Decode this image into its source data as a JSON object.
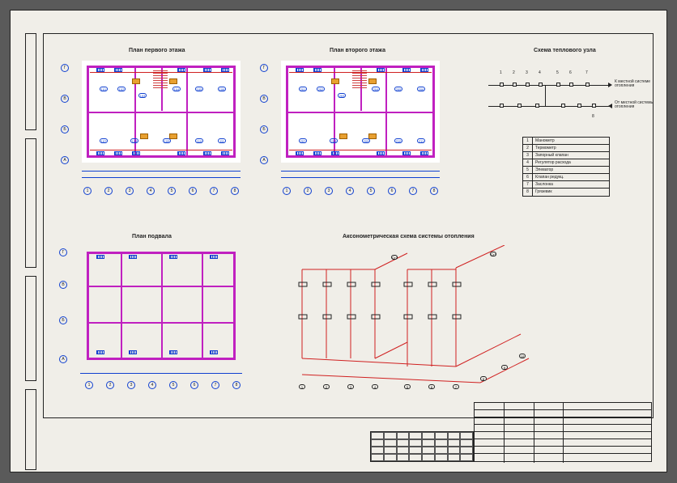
{
  "titles": {
    "plan1": "План первого этажа",
    "plan2": "План второго этажа",
    "thermal": "Схема теплового узла",
    "basement": "План подвала",
    "axo": "Аксонометрическая схема системы отопления"
  },
  "thermal_labels": {
    "to_local": "К местной системе отопления",
    "from_local": "От местной системы отопления"
  },
  "legend": [
    {
      "n": "1",
      "t": "Манометр"
    },
    {
      "n": "2",
      "t": "Термометр"
    },
    {
      "n": "3",
      "t": "Запорный клапан"
    },
    {
      "n": "4",
      "t": "Регулятор расхода"
    },
    {
      "n": "5",
      "t": "Элеватор"
    },
    {
      "n": "6",
      "t": "Клапан редукц."
    },
    {
      "n": "7",
      "t": "Заслонка"
    },
    {
      "n": "8",
      "t": "Грязевик"
    }
  ],
  "grid_axes_letters": [
    "А",
    "Б",
    "В",
    "Г"
  ],
  "grid_axes_numbers": [
    "1",
    "2",
    "3",
    "4",
    "5",
    "6",
    "7",
    "8"
  ],
  "room_tags": [
    "101",
    "102",
    "103",
    "104",
    "105",
    "106",
    "107",
    "108",
    "109",
    "110",
    "111",
    "112"
  ]
}
